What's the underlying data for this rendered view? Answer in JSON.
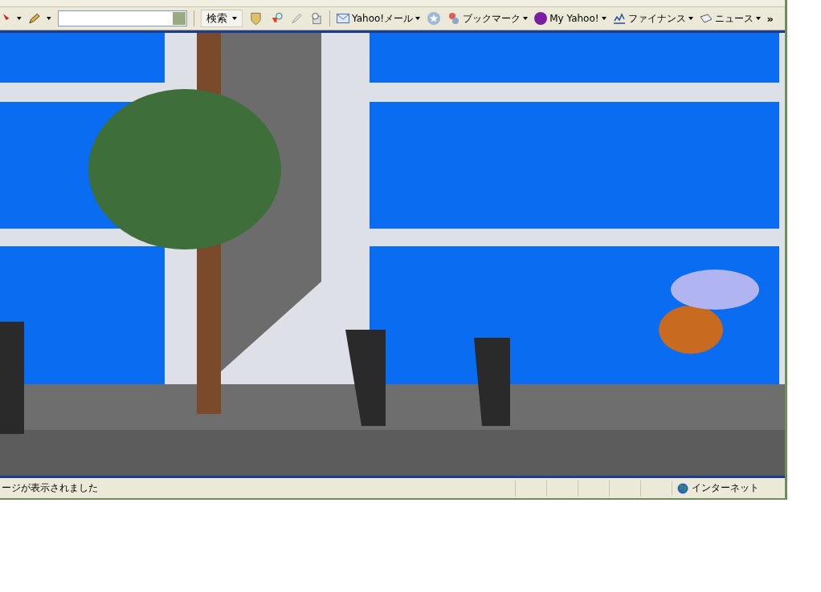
{
  "toolbar": {
    "search_button": "検索",
    "links": [
      {
        "kind": "mail",
        "label": "Yahoo!メール",
        "dropdown": true
      },
      {
        "kind": "star",
        "dropdown": false
      },
      {
        "kind": "bookmark",
        "label": "ブックマーク",
        "dropdown": true
      },
      {
        "kind": "myyahoo",
        "label": "My Yahoo!",
        "dropdown": true
      },
      {
        "kind": "finance",
        "label": "ファイナンス",
        "dropdown": true
      },
      {
        "kind": "news",
        "label": "ニュース",
        "dropdown": true
      }
    ],
    "overflow": "»"
  },
  "status_bar": {
    "message": "ージが表示されました",
    "zone": "インターネット"
  }
}
